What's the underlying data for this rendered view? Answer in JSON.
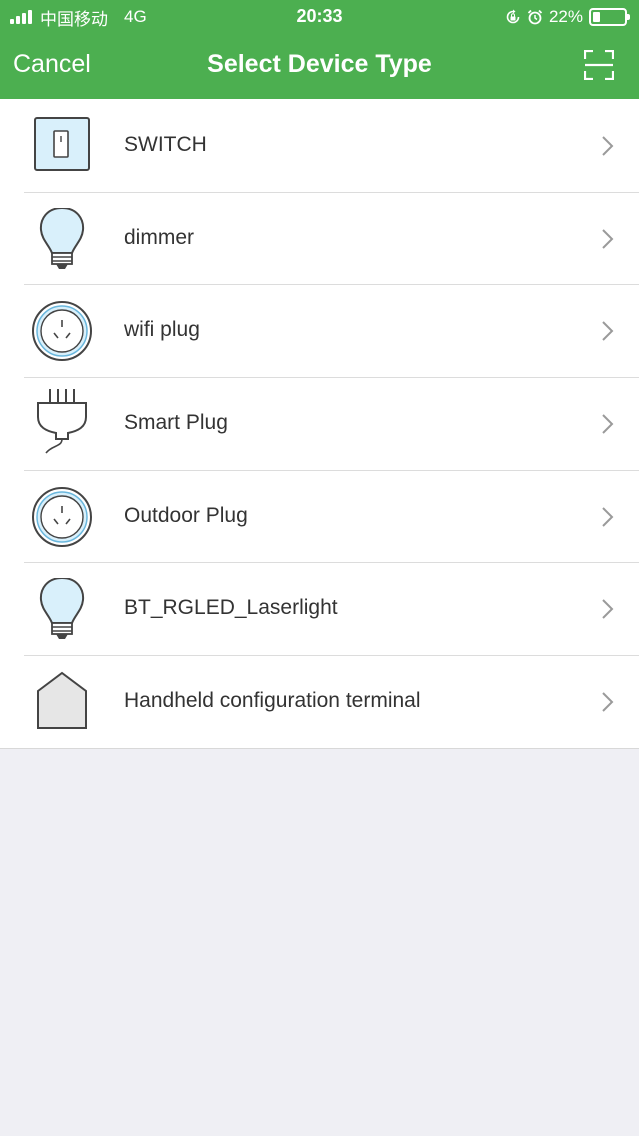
{
  "status_bar": {
    "carrier": "中国移动",
    "network": "4G",
    "time": "20:33",
    "battery_percent": "22%",
    "battery_level": 0.22,
    "icons": [
      "signal-icon",
      "rotation-lock-icon",
      "alarm-icon",
      "battery-icon"
    ]
  },
  "nav": {
    "cancel_label": "Cancel",
    "title": "Select Device Type",
    "scan_icon": "scan-icon"
  },
  "devices": [
    {
      "label": "SWITCH",
      "icon": "switch-icon"
    },
    {
      "label": "dimmer",
      "icon": "bulb-icon"
    },
    {
      "label": "wifi plug",
      "icon": "socket-icon"
    },
    {
      "label": "Smart Plug",
      "icon": "plug-icon"
    },
    {
      "label": "Outdoor Plug",
      "icon": "socket-icon"
    },
    {
      "label": "BT_RGLED_Laserlight",
      "icon": "bulb-icon"
    },
    {
      "label": "Handheld configuration terminal",
      "icon": "house-icon"
    }
  ],
  "colors": {
    "header": "#4caf50",
    "background": "#efeff4",
    "icon_fill": "#d9f0fb",
    "icon_stroke": "#444444"
  }
}
